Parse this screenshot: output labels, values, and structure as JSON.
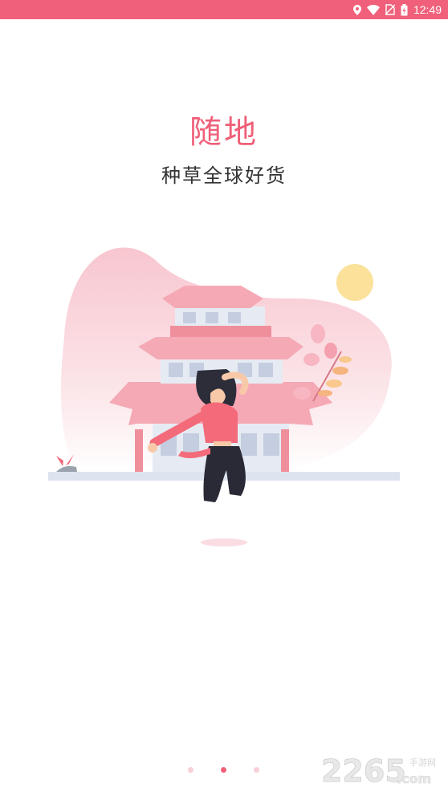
{
  "status_bar": {
    "time": "12:49",
    "icons": [
      "location-icon",
      "wifi-icon",
      "no-sim-icon",
      "battery-icon"
    ]
  },
  "onboarding": {
    "title": "随地",
    "subtitle": "种草全球好货",
    "page_indicator": {
      "total": 3,
      "active": 2
    }
  },
  "watermark": {
    "number": "2265",
    "suffix": ".com",
    "cn": "手游网"
  },
  "colors": {
    "accent": "#ef5f78",
    "status_bar": "#f0607a",
    "sun": "#fbe19a",
    "ground": "#dde4f0"
  }
}
